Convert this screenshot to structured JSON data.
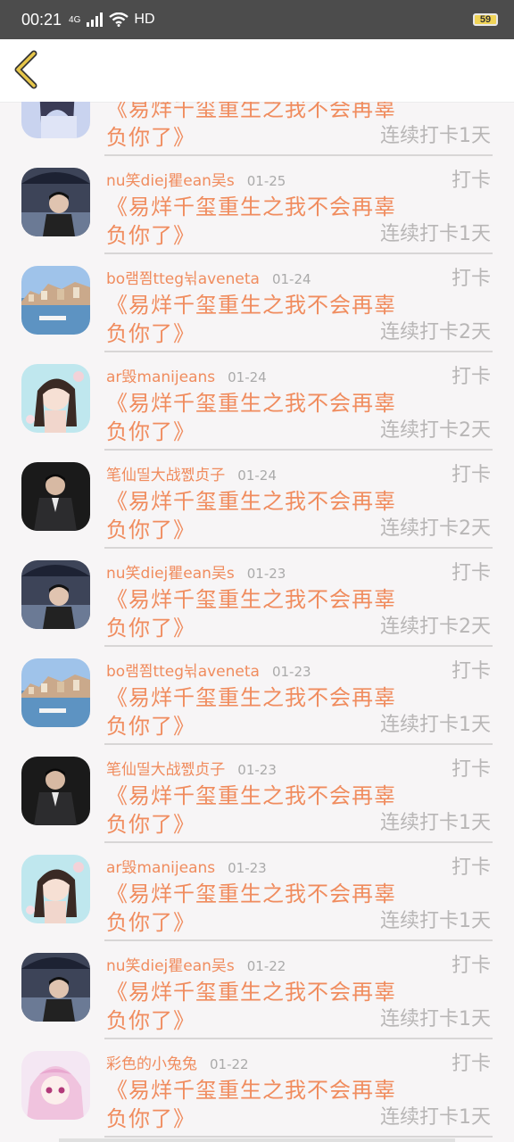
{
  "status_bar": {
    "time": "00:21",
    "network": "4G",
    "hd": "HD",
    "battery": "59"
  },
  "header": {
    "back_icon": "chevron-left-icon"
  },
  "colors": {
    "accent": "#f08c5e",
    "muted": "#b8b6b6",
    "back": "#e6c64a"
  },
  "items": [
    {
      "name": "",
      "date": "",
      "action": "",
      "title_line1": "《易烊千玺重生之我不会再辜",
      "title_line2": "负你了》",
      "streak": "连续打卡1天",
      "avatar": "girl-blue"
    },
    {
      "name": "nu笑diej瞿ean吴s",
      "date": "01-25",
      "action": "打卡",
      "title_line1": "《易烊千玺重生之我不会再辜",
      "title_line2": "负你了》",
      "streak": "连续打卡1天",
      "avatar": "boy-umbrella"
    },
    {
      "name": "bo램쬠tteg뉚aveneta",
      "date": "01-24",
      "action": "打卡",
      "title_line1": "《易烊千玺重生之我不会再辜",
      "title_line2": "负你了》",
      "streak": "连续打卡2天",
      "avatar": "town-sea"
    },
    {
      "name": "ar毁manijeans",
      "date": "01-24",
      "action": "打卡",
      "title_line1": "《易烊千玺重生之我不会再辜",
      "title_line2": "负你了》",
      "streak": "连续打卡2天",
      "avatar": "girl-flowers"
    },
    {
      "name": "笔仙띨大战쩴贞子",
      "date": "01-24",
      "action": "打卡",
      "title_line1": "《易烊千玺重生之我不会再辜",
      "title_line2": "负你了》",
      "streak": "连续打卡2天",
      "avatar": "man-suit"
    },
    {
      "name": "nu笑diej瞿ean吴s",
      "date": "01-23",
      "action": "打卡",
      "title_line1": "《易烊千玺重生之我不会再辜",
      "title_line2": "负你了》",
      "streak": "连续打卡2天",
      "avatar": "boy-umbrella"
    },
    {
      "name": "bo램쬠tteg뉚aveneta",
      "date": "01-23",
      "action": "打卡",
      "title_line1": "《易烊千玺重生之我不会再辜",
      "title_line2": "负你了》",
      "streak": "连续打卡1天",
      "avatar": "town-sea"
    },
    {
      "name": "笔仙띨大战쩴贞子",
      "date": "01-23",
      "action": "打卡",
      "title_line1": "《易烊千玺重生之我不会再辜",
      "title_line2": "负你了》",
      "streak": "连续打卡1天",
      "avatar": "man-suit"
    },
    {
      "name": "ar毁manijeans",
      "date": "01-23",
      "action": "打卡",
      "title_line1": "《易烊千玺重生之我不会再辜",
      "title_line2": "负你了》",
      "streak": "连续打卡1天",
      "avatar": "girl-flowers"
    },
    {
      "name": "nu笑diej瞿ean吴s",
      "date": "01-22",
      "action": "打卡",
      "title_line1": "《易烊千玺重生之我不会再辜",
      "title_line2": "负你了》",
      "streak": "连续打卡1天",
      "avatar": "boy-umbrella"
    },
    {
      "name": "彩色的小兔兔",
      "date": "01-22",
      "action": "打卡",
      "title_line1": "《易烊千玺重生之我不会再辜",
      "title_line2": "负你了》",
      "streak": "连续打卡1天",
      "avatar": "anime-girl"
    }
  ]
}
